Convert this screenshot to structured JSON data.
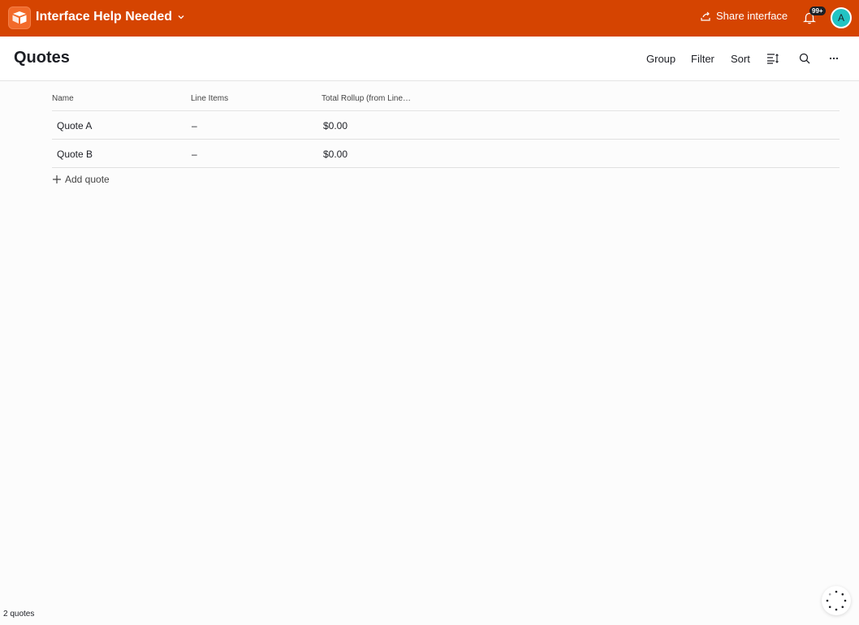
{
  "topbar": {
    "app_title": "Interface Help Needed",
    "share_label": "Share interface",
    "notification_badge": "99+",
    "avatar_initial": "A",
    "brand_color": "#d54401"
  },
  "page": {
    "title": "Quotes"
  },
  "toolbar": {
    "group_label": "Group",
    "filter_label": "Filter",
    "sort_label": "Sort"
  },
  "table": {
    "columns": [
      "Name",
      "Line Items",
      "Total Rollup (from Line…"
    ],
    "rows": [
      {
        "name": "Quote A",
        "line_items": "–",
        "total": "$0.00"
      },
      {
        "name": "Quote B",
        "line_items": "–",
        "total": "$0.00"
      }
    ],
    "add_label": "Add quote"
  },
  "footer": {
    "count_label": "2 quotes"
  },
  "icons": {
    "logo": "airtable-logo-icon",
    "share": "share-arrow-icon",
    "bell": "bell-icon",
    "row_height": "row-height-icon",
    "search": "search-icon",
    "more": "more-horizontal-icon",
    "add": "plus-icon",
    "loader": "loading-spinner-icon"
  }
}
